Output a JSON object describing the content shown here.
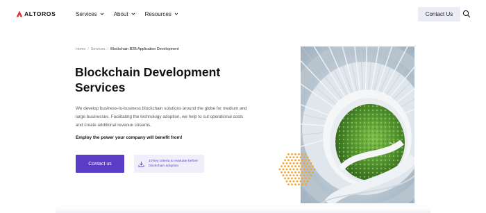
{
  "brand": {
    "name": "ALTOROS",
    "accent": "#e5322d"
  },
  "nav": {
    "items": [
      {
        "label": "Services"
      },
      {
        "label": "About"
      },
      {
        "label": "Resources"
      }
    ],
    "contact_label": "Contact Us"
  },
  "breadcrumb": {
    "items": [
      "Home",
      "Services"
    ],
    "current": "Blockchain B2B Application Development"
  },
  "hero": {
    "title_line1": "Blockchain Development",
    "title_line2": "Services",
    "description": "We develop business-to-business blockchain solutions around the globe for medium and large businesses. Facilitating the technology adoption, we help to cut operational costs and create additional revenue streams.",
    "emphasis": "Employ the power your company will benefit from!",
    "contact_button": "Contact us",
    "download_text": "10 key criteria to evaluate before blockchain adoption"
  },
  "colors": {
    "primary": "#5b3cc4",
    "primary_light": "#f1eefb",
    "nav_button_bg": "#ececf7",
    "dots": "#f4a531"
  },
  "icons": [
    "altoros-logo-icon",
    "chevron-down-icon",
    "search-icon",
    "download-icon"
  ]
}
